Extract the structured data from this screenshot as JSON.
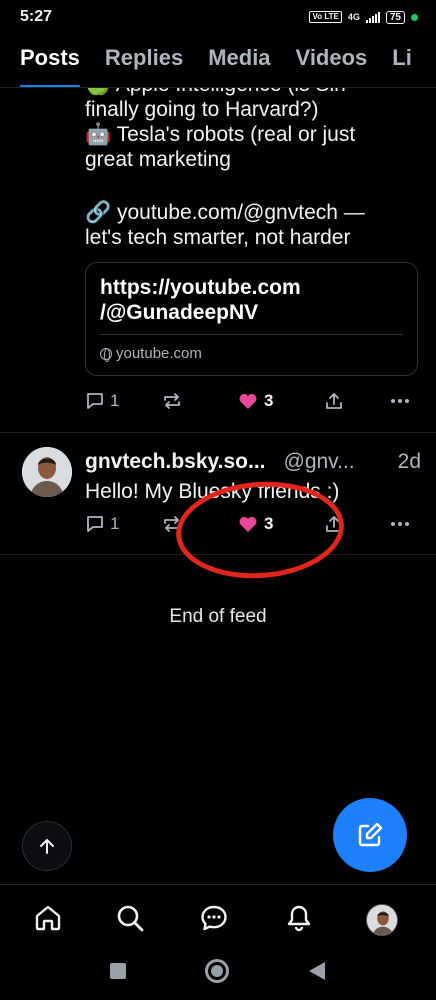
{
  "status": {
    "time": "5:27",
    "volte": "Vo LTE",
    "network": "4G",
    "battery": "75"
  },
  "tabs": [
    {
      "label": "Posts",
      "active": true
    },
    {
      "label": "Replies",
      "active": false
    },
    {
      "label": "Media",
      "active": false
    },
    {
      "label": "Videos",
      "active": false
    },
    {
      "label": "Li",
      "active": false
    }
  ],
  "post1": {
    "lines_partial": "🍏 Apple Intelligence (is Siri",
    "lines": [
      "finally going to Harvard?)",
      "🤖 Tesla's robots (real or just",
      "great marketing"
    ],
    "link_line": [
      "🔗 youtube.com/@gnvtech —",
      "let's tech smarter, not harder"
    ],
    "card": {
      "title_line1": "https://youtube.com",
      "title_line2": "/@GunadeepNV",
      "domain": "youtube.com"
    },
    "actions": {
      "replies": "1",
      "likes": "3"
    }
  },
  "post2": {
    "display_name": "gnvtech.bsky.so...",
    "handle": "@gnv...",
    "time": "2d",
    "text": "Hello! My Bluesky friends :)",
    "actions": {
      "replies": "1",
      "likes": "3"
    }
  },
  "feed": {
    "end_text": "End of feed"
  },
  "colors": {
    "accent": "#1083fe",
    "fab": "#1f80fb",
    "like": "#ec4899",
    "annotation": "#e3261d"
  },
  "icons": {
    "bottom_nav": [
      "home-icon",
      "search-icon",
      "chat-icon",
      "bell-icon",
      "profile-avatar"
    ],
    "post_actions": [
      "reply-icon",
      "repost-icon",
      "heart-icon",
      "share-icon",
      "more-icon"
    ]
  }
}
